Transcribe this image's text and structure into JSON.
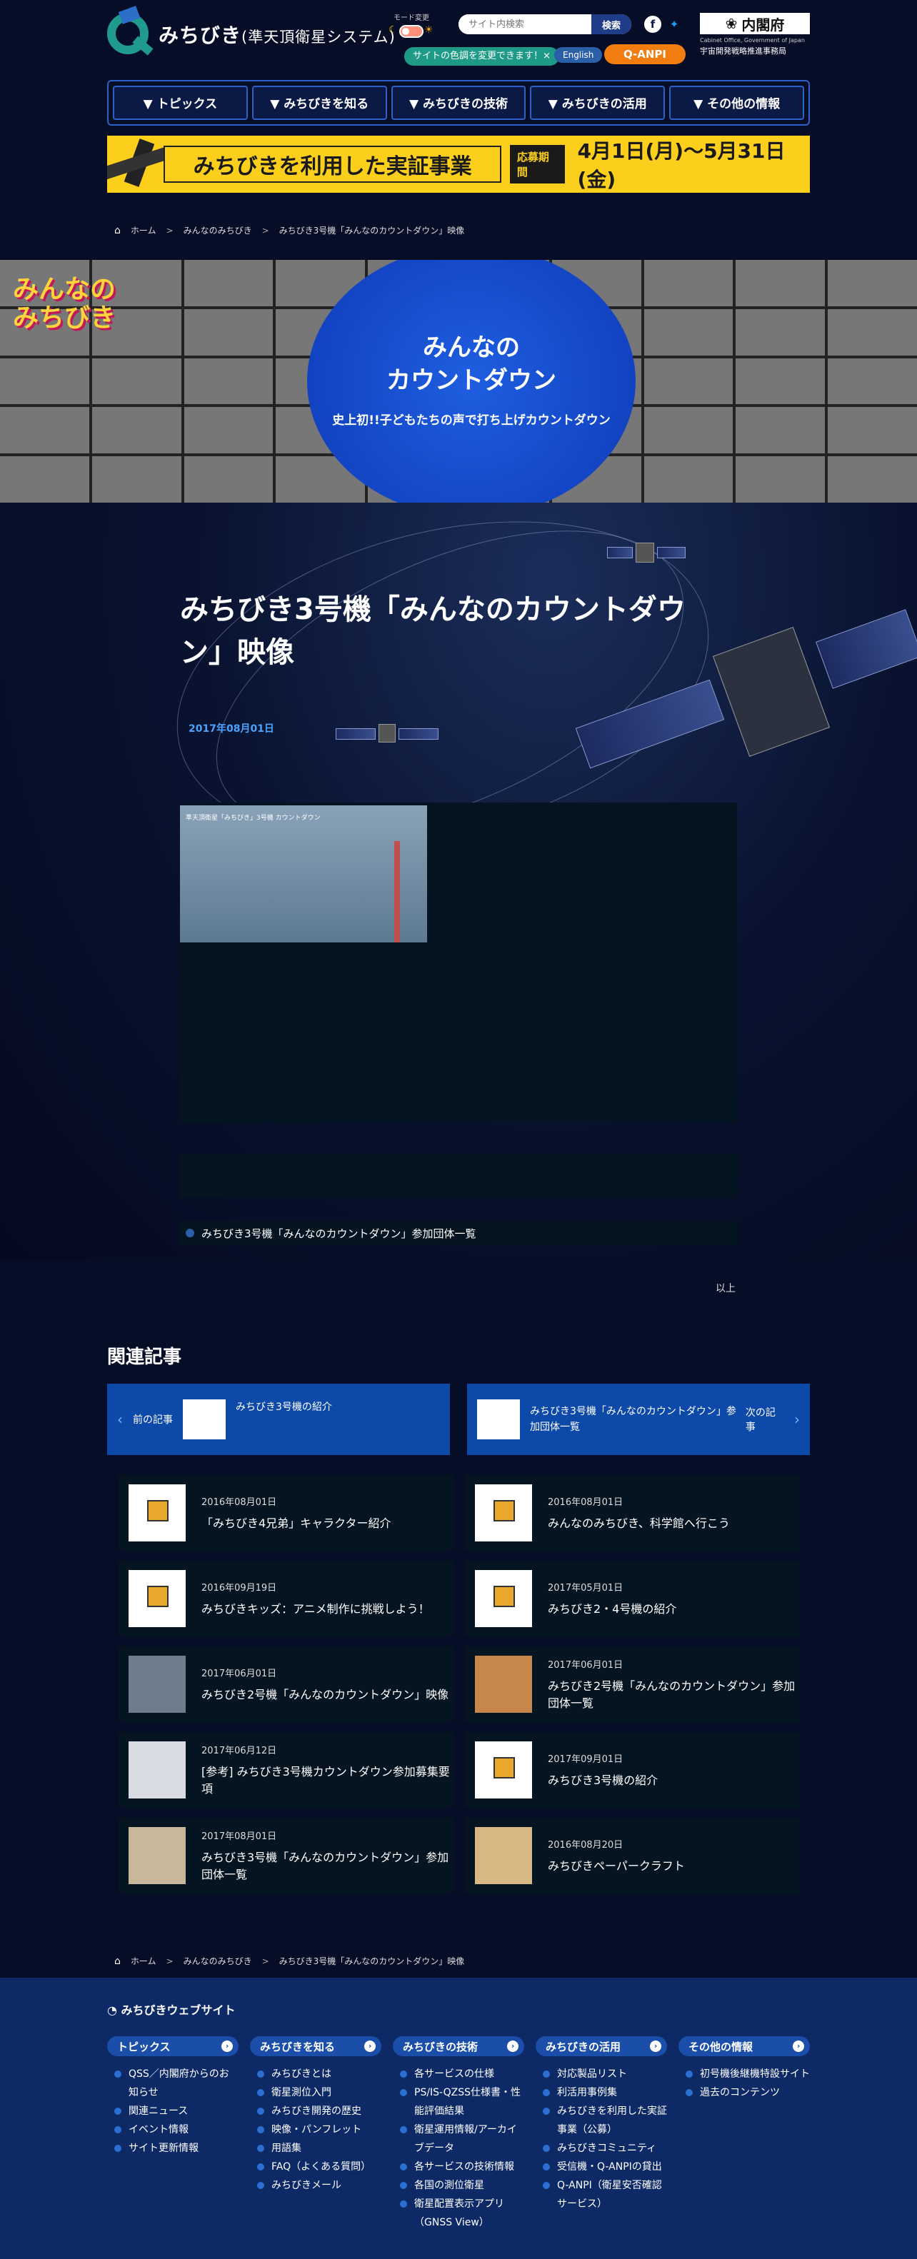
{
  "header": {
    "logo": {
      "title": "みちびき",
      "subtitle": "(準天頂衛星システム)"
    },
    "mode_label": "モード変更",
    "mode_hint": "サイトの色調を変更できます！×",
    "search_placeholder": "サイト内検索",
    "search_button": "検索",
    "english_link": "English",
    "qanpi_button": "Q-ANPI",
    "cabinet": {
      "name": "内閣府",
      "en": "Cabinet Office, Government of Japan",
      "office": "宇宙開発戦略推進事務局"
    }
  },
  "nav": [
    "トピックス",
    "みちびきを知る",
    "みちびきの技術",
    "みちびきの活用",
    "その他の情報"
  ],
  "banner": {
    "title": "みちびきを利用した実証事業",
    "tag": "応募期間",
    "date": "4月1日(月)〜5月31日(金)"
  },
  "breadcrumb": [
    "ホーム",
    "みんなのみちびき",
    "みちびき3号機「みんなのカウントダウン」映像"
  ],
  "hero": {
    "logo_text": "みんなの\nみちびき",
    "title": "みんなの\nカウントダウン",
    "subtitle": "史上初!!子どもたちの声で打ち上げカウントダウン"
  },
  "article": {
    "title": "みちびき3号機「みんなのカウントダウン」映像",
    "date": "2017年08月01日",
    "video_caption": "準天頂衛星「みちびき」3号機 カウントダウン",
    "link": "みちびき3号機「みんなのカウントダウン」参加団体一覧",
    "end": "以上"
  },
  "related": {
    "title": "関連記事",
    "prev": {
      "label": "前の記事",
      "title": "みちびき3号機の紹介"
    },
    "next": {
      "label": "次の記事",
      "title": "みちびき3号機「みんなのカウントダウン」参加団体一覧"
    },
    "cards": [
      {
        "date": "2016年08月01日",
        "title": "「みちびき4兄弟」キャラクター紹介"
      },
      {
        "date": "2016年08月01日",
        "title": "みんなのみちびき、科学館へ行こう"
      },
      {
        "date": "2016年09月19日",
        "title": "みちびきキッズ：アニメ制作に挑戦しよう！"
      },
      {
        "date": "2017年05月01日",
        "title": "みちびき2・4号機の紹介"
      },
      {
        "date": "2017年06月01日",
        "title": "みちびき2号機「みんなのカウントダウン」映像"
      },
      {
        "date": "2017年06月01日",
        "title": "みちびき2号機「みんなのカウントダウン」参加団体一覧"
      },
      {
        "date": "2017年06月12日",
        "title": "[参考] みちびき3号機カウントダウン参加募集要項"
      },
      {
        "date": "2017年09月01日",
        "title": "みちびき3号機の紹介"
      },
      {
        "date": "2017年08月01日",
        "title": "みちびき3号機「みんなのカウントダウン」参加団体一覧"
      },
      {
        "date": "2016年08月20日",
        "title": "みちびきペーパークラフト"
      }
    ]
  },
  "footer": {
    "title": "みちびきウェブサイト",
    "columns": [
      {
        "head": "トピックス",
        "items": [
          "QSS／内閣府からのお知らせ",
          "関連ニュース",
          "イベント情報",
          "サイト更新情報"
        ]
      },
      {
        "head": "みちびきを知る",
        "items": [
          "みちびきとは",
          "衛星測位入門",
          "みちびき開発の歴史",
          "映像・パンフレット",
          "用語集",
          "FAQ（よくある質問）",
          "みちびきメール"
        ]
      },
      {
        "head": "みちびきの技術",
        "items": [
          "各サービスの仕様",
          "PS/IS-QZSS仕様書・性能評価結果",
          "衛星運用情報/アーカイブデータ",
          "各サービスの技術情報",
          "各国の測位衛星",
          "衛星配置表示アプリ（GNSS View）"
        ]
      },
      {
        "head": "みちびきの活用",
        "items": [
          "対応製品リスト",
          "利活用事例集",
          "みちびきを利用した実証事業（公募）",
          "みちびきコミュニティ",
          "受信機・Q-ANPIの貸出",
          "Q-ANPI（衛星安否確認サービス）"
        ]
      },
      {
        "head": "その他の情報",
        "items": [
          "初号機後継機特設サイト",
          "過去のコンテンツ"
        ]
      }
    ]
  }
}
